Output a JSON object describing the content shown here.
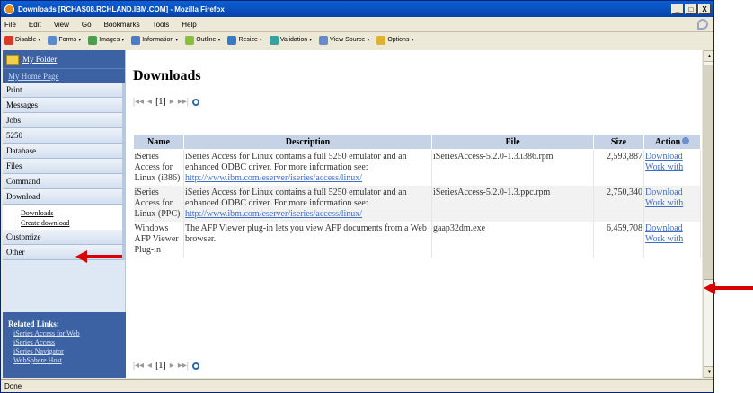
{
  "window": {
    "title": "Downloads [RCHAS08.RCHLAND.IBM.COM] - Mozilla Firefox",
    "controls": [
      "_",
      "□",
      "X"
    ]
  },
  "menubar": [
    "File",
    "Edit",
    "View",
    "Go",
    "Bookmarks",
    "Tools",
    "Help"
  ],
  "devtoolbar": [
    {
      "label": "Disable",
      "icon": "disable-icon",
      "color": "#d83a2a"
    },
    {
      "label": "Forms",
      "icon": "forms-icon",
      "color": "#5a8ad0"
    },
    {
      "label": "Images",
      "icon": "images-icon",
      "color": "#4aa04a"
    },
    {
      "label": "Information",
      "icon": "information-icon",
      "color": "#4c7cc8"
    },
    {
      "label": "Outline",
      "icon": "outline-icon",
      "color": "#8abf3a"
    },
    {
      "label": "Resize",
      "icon": "resize-icon",
      "color": "#3a78c8"
    },
    {
      "label": "Validation",
      "icon": "validation-icon",
      "color": "#3aa0a0"
    },
    {
      "label": "View Source",
      "icon": "view-source-icon",
      "color": "#6a8acb"
    },
    {
      "label": "Options",
      "icon": "options-icon",
      "color": "#e0b030"
    }
  ],
  "sidebar": {
    "folder": "My Folder",
    "home": "My Home Page",
    "items": [
      "Print",
      "Messages",
      "Jobs",
      "5250",
      "Database",
      "Files",
      "Command",
      "Download"
    ],
    "subitems": [
      "Downloads",
      "Create download"
    ],
    "items_after": [
      "Customize",
      "Other"
    ],
    "related_heading": "Related Links:",
    "related_links": [
      "iSeries Access for Web",
      "iSeries Access",
      "iSeries Navigator",
      "WebSphere Host"
    ]
  },
  "main": {
    "title": "Downloads",
    "pager_page": "[1]",
    "columns": [
      "Name",
      "Description",
      "File",
      "Size",
      "Action"
    ],
    "rows": [
      {
        "name": "iSeries Access for Linux (i386)",
        "description": "iSeries Access for Linux contains a full 5250 emulator and an enhanced ODBC driver. For more information see:",
        "url": "http://www.ibm.com/eserver/iseries/access/linux/",
        "file": "iSeriesAccess-5.2.0-1.3.i386.rpm",
        "size": "2,593,887",
        "action1": "Download",
        "action2": "Work with"
      },
      {
        "name": "iSeries Access for Linux (PPC)",
        "description": "iSeries Access for Linux contains a full 5250 emulator and an enhanced ODBC driver. For more information see:",
        "url": "http://www.ibm.com/eserver/iseries/access/linux/",
        "file": "iSeriesAccess-5.2.0-1.3.ppc.rpm",
        "size": "2,750,340",
        "action1": "Download",
        "action2": "Work with"
      },
      {
        "name": "Windows AFP Viewer Plug-in",
        "description": "The AFP Viewer plug-in lets you view AFP documents from a Web browser.",
        "url": "",
        "file": "gaap32dm.exe",
        "size": "6,459,708",
        "action1": "Download",
        "action2": "Work with"
      }
    ]
  },
  "status": "Done",
  "colors": {
    "sidebar_blue": "#3d62a3",
    "link": "#3d6fc4",
    "arrow": "#d80000",
    "header": "#c6d3e6"
  }
}
